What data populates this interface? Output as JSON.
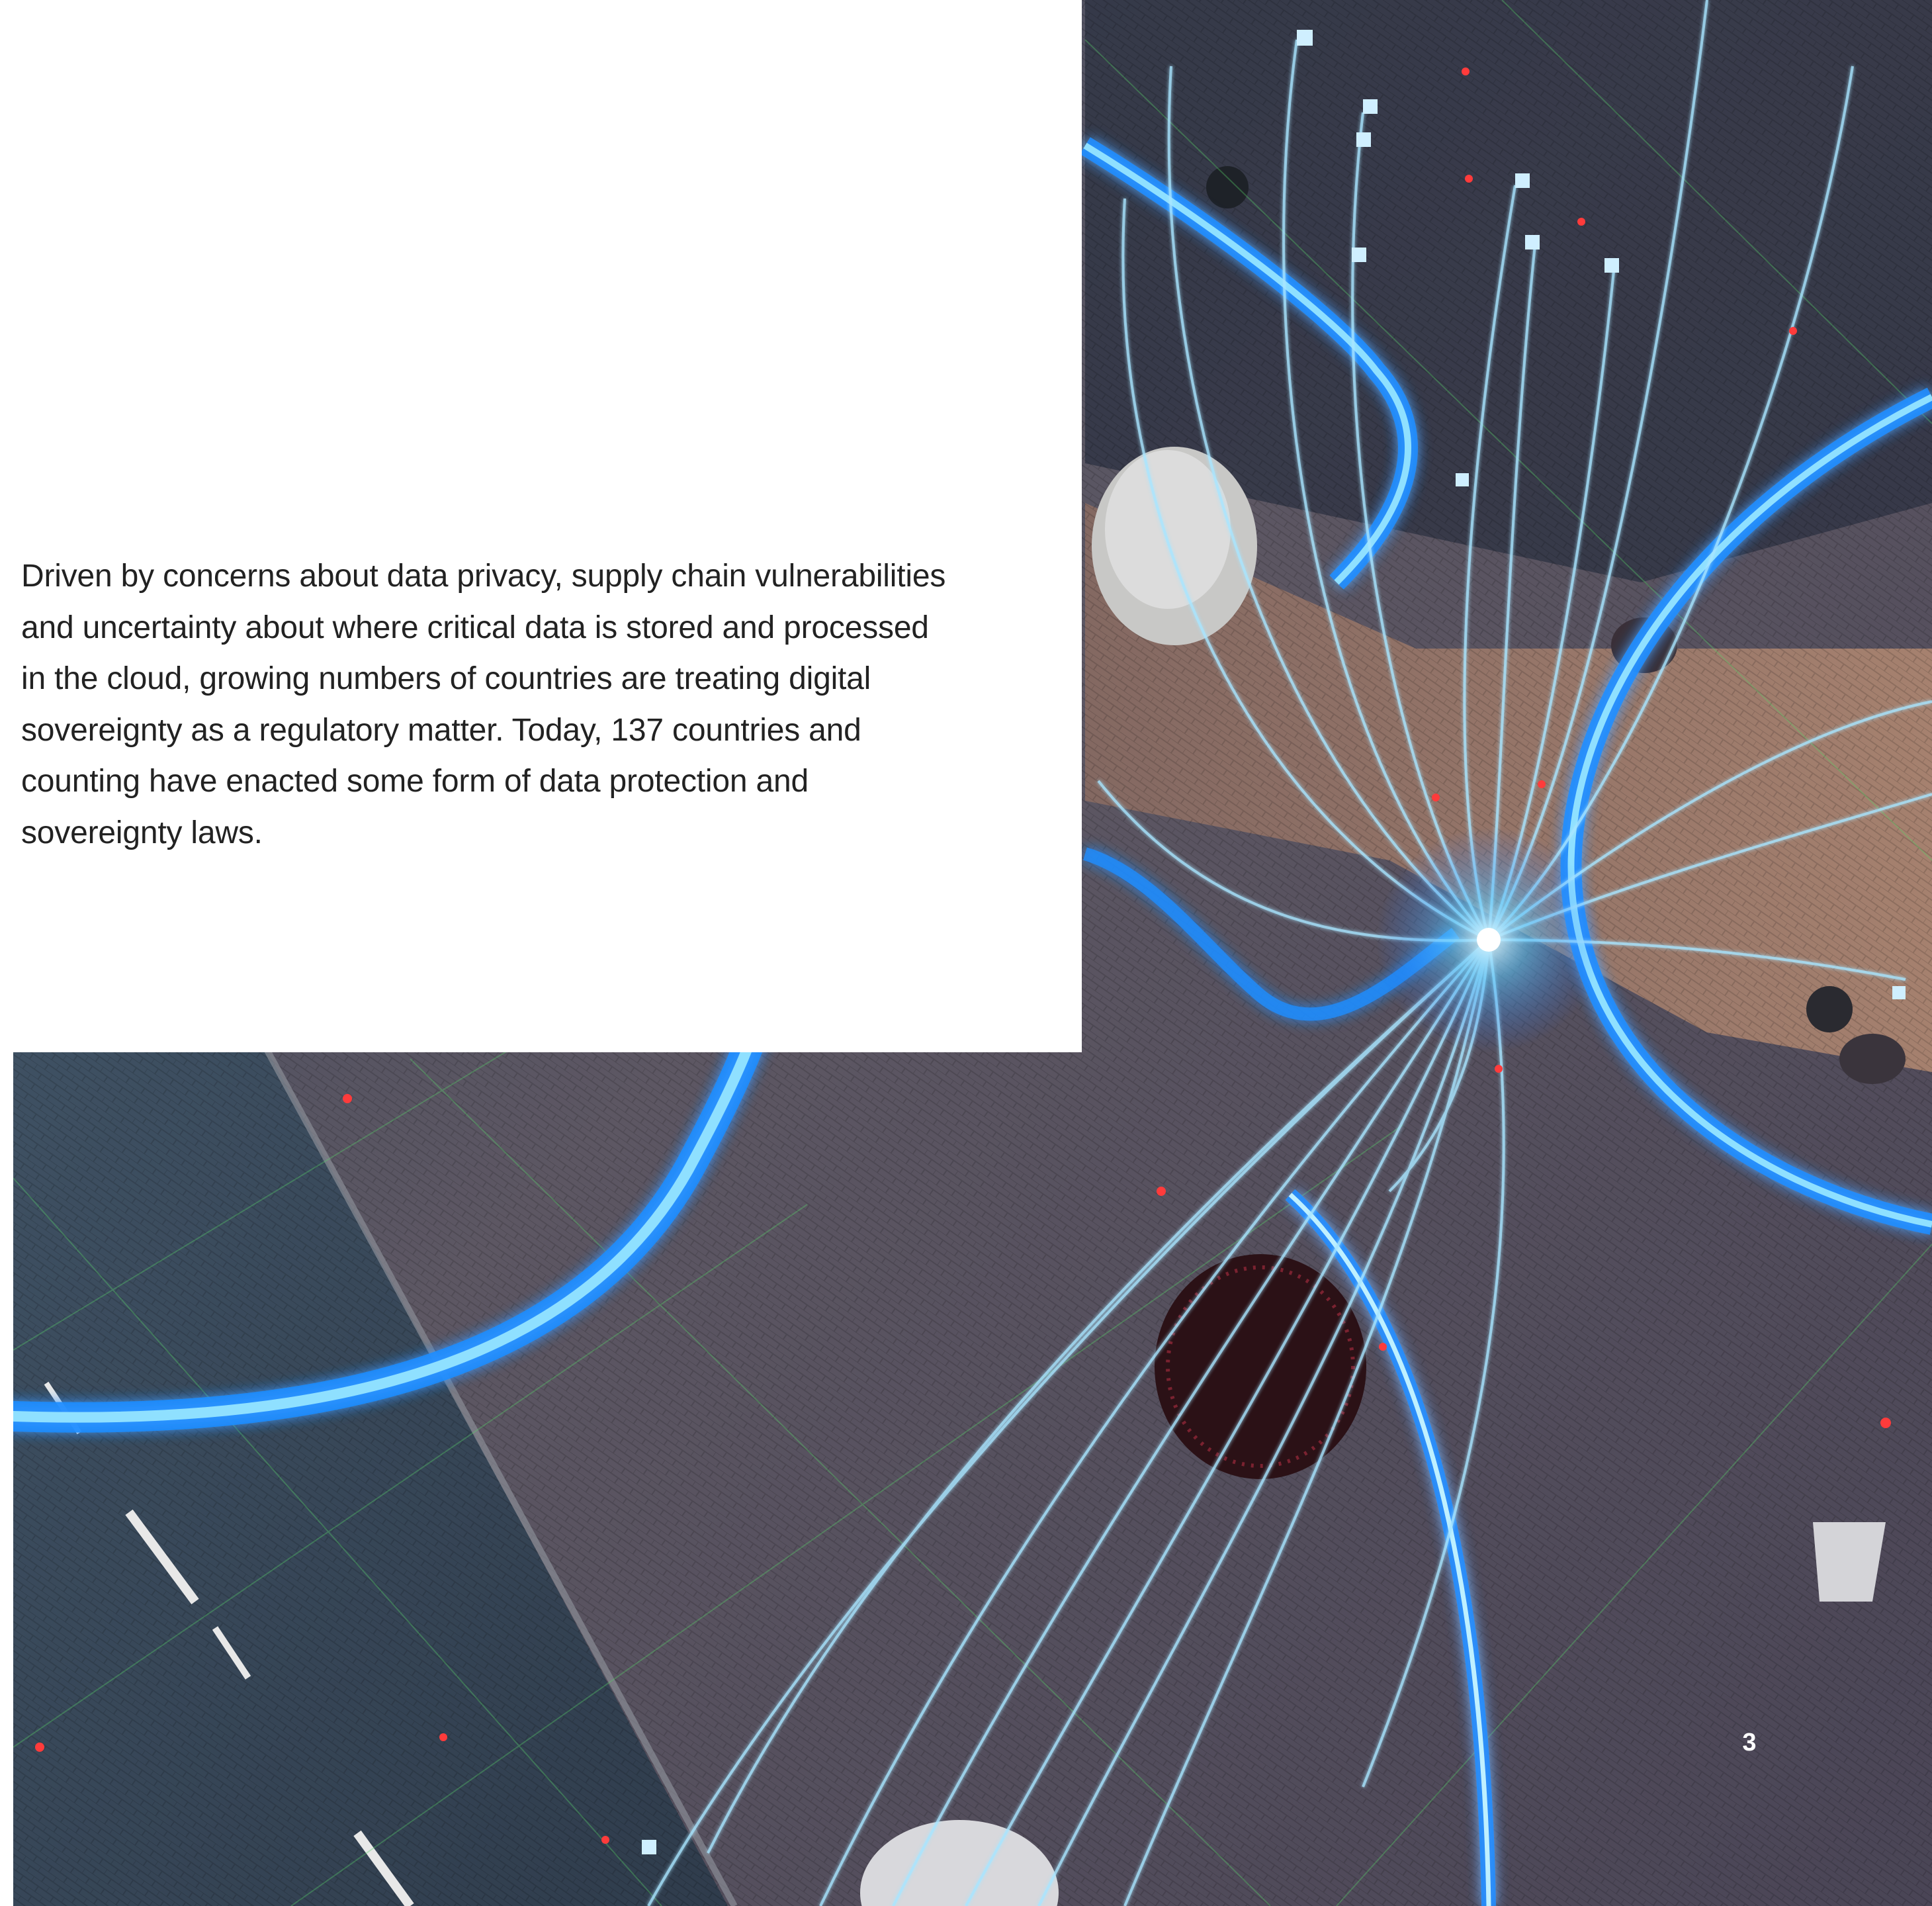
{
  "body": {
    "paragraph": "Driven by concerns about data privacy, supply chain vulnerabilities and uncertainty about where critical data is stored and processed in the cloud, growing numbers of countries are treating digital sovereignty as a regulatory matter. Today, 137 countries and counting have enacted some form of data protection and sovereignty laws."
  },
  "page_number": "3",
  "colors": {
    "panel_background": "#ffffff",
    "body_text": "#222222",
    "page_number": "#ffffff",
    "light_trail_glow": "#2a9cff",
    "light_trail_core": "#9fe3ff",
    "pavement": "#5a5360",
    "sunlit_pavement": "#9a7662"
  }
}
